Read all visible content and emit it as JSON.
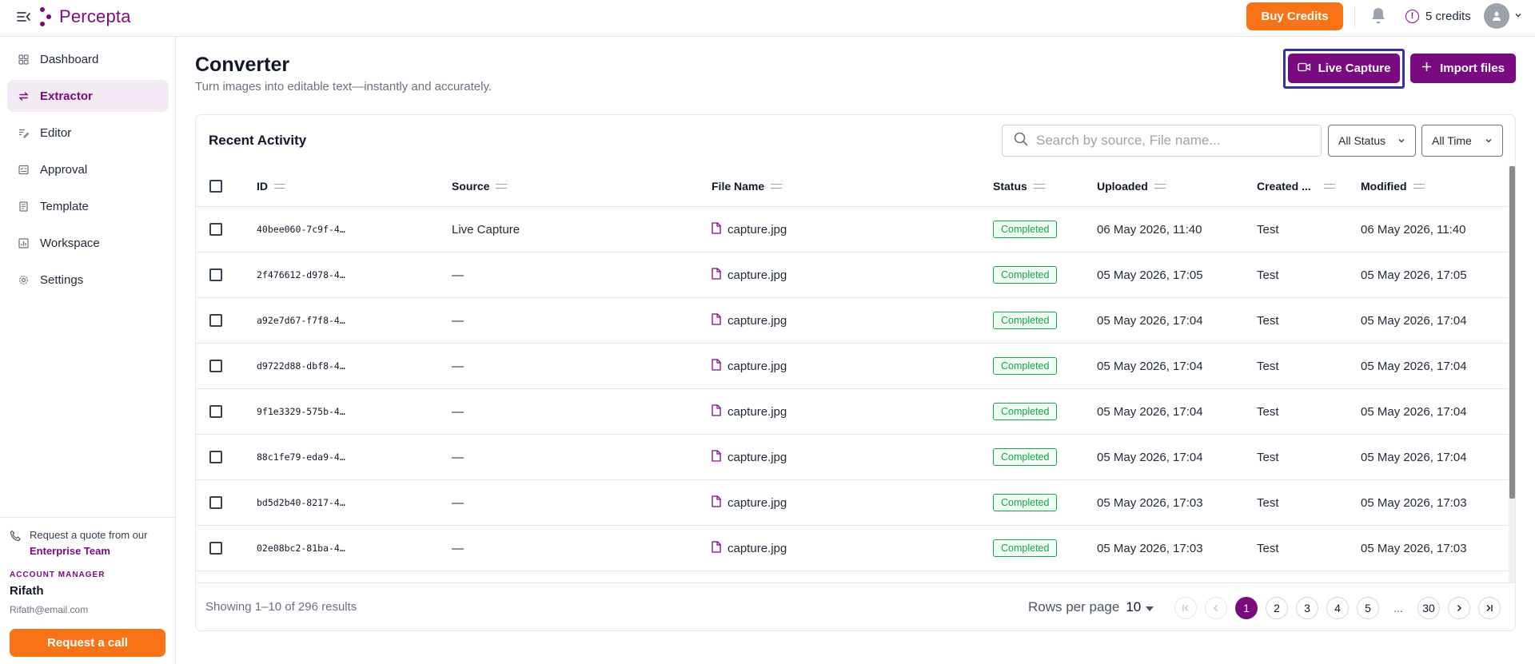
{
  "app": {
    "name": "Percepta"
  },
  "header": {
    "buy_credits": "Buy Credits",
    "credits": "5 credits"
  },
  "sidebar": {
    "items": [
      {
        "label": "Dashboard",
        "icon": "dashboard-icon",
        "active": false
      },
      {
        "label": "Extractor",
        "icon": "convert-icon",
        "active": true
      },
      {
        "label": "Editor",
        "icon": "edit-icon",
        "active": false
      },
      {
        "label": "Approval",
        "icon": "approval-icon",
        "active": false
      },
      {
        "label": "Template",
        "icon": "template-icon",
        "active": false
      },
      {
        "label": "Workspace",
        "icon": "workspace-icon",
        "active": false
      },
      {
        "label": "Settings",
        "icon": "gear-icon",
        "active": false
      }
    ],
    "quote_text": "Request a quote from our",
    "quote_link": "Enterprise Team",
    "account_manager_label": "ACCOUNT MANAGER",
    "account_manager_name": "Rifath",
    "account_manager_email": "Rifath@email.com",
    "request_call": "Request a call"
  },
  "page": {
    "title": "Converter",
    "subtitle": "Turn images into editable text—instantly and accurately.",
    "live_capture": "Live Capture",
    "import_files": "Import files"
  },
  "activity": {
    "title": "Recent Activity",
    "search_placeholder": "Search by source, File name...",
    "status_filter": "All Status",
    "time_filter": "All Time",
    "columns": {
      "id": "ID",
      "source": "Source",
      "file_name": "File Name",
      "status": "Status",
      "uploaded": "Uploaded",
      "created": "Created ...",
      "modified": "Modified"
    },
    "rows": [
      {
        "id": "40bee060-7c9f-4…",
        "source": "Live Capture",
        "file": "capture.jpg",
        "status": "Completed",
        "uploaded": "06 May 2026, 11:40",
        "created": "Test",
        "modified": "06 May 2026, 11:40"
      },
      {
        "id": "2f476612-d978-4…",
        "source": "—",
        "file": "capture.jpg",
        "status": "Completed",
        "uploaded": "05 May 2026, 17:05",
        "created": "Test",
        "modified": "05 May 2026, 17:05"
      },
      {
        "id": "a92e7d67-f7f8-4…",
        "source": "—",
        "file": "capture.jpg",
        "status": "Completed",
        "uploaded": "05 May 2026, 17:04",
        "created": "Test",
        "modified": "05 May 2026, 17:04"
      },
      {
        "id": "d9722d88-dbf8-4…",
        "source": "—",
        "file": "capture.jpg",
        "status": "Completed",
        "uploaded": "05 May 2026, 17:04",
        "created": "Test",
        "modified": "05 May 2026, 17:04"
      },
      {
        "id": "9f1e3329-575b-4…",
        "source": "—",
        "file": "capture.jpg",
        "status": "Completed",
        "uploaded": "05 May 2026, 17:04",
        "created": "Test",
        "modified": "05 May 2026, 17:04"
      },
      {
        "id": "88c1fe79-eda9-4…",
        "source": "—",
        "file": "capture.jpg",
        "status": "Completed",
        "uploaded": "05 May 2026, 17:04",
        "created": "Test",
        "modified": "05 May 2026, 17:04"
      },
      {
        "id": "bd5d2b40-8217-4…",
        "source": "—",
        "file": "capture.jpg",
        "status": "Completed",
        "uploaded": "05 May 2026, 17:03",
        "created": "Test",
        "modified": "05 May 2026, 17:03"
      },
      {
        "id": "02e08bc2-81ba-4…",
        "source": "—",
        "file": "capture.jpg",
        "status": "Completed",
        "uploaded": "05 May 2026, 17:03",
        "created": "Test",
        "modified": "05 May 2026, 17:03"
      }
    ],
    "showing": "Showing 1–10 of 296 results",
    "rows_per_page_label": "Rows per page",
    "rows_per_page": "10",
    "pages": [
      "1",
      "2",
      "3",
      "4",
      "5",
      "...",
      "30"
    ],
    "current_page": "1"
  },
  "colors": {
    "brand": "#7a0a7f",
    "accent": "#f97316",
    "success": "#16a34a",
    "focus_ring": "#3730a3"
  }
}
